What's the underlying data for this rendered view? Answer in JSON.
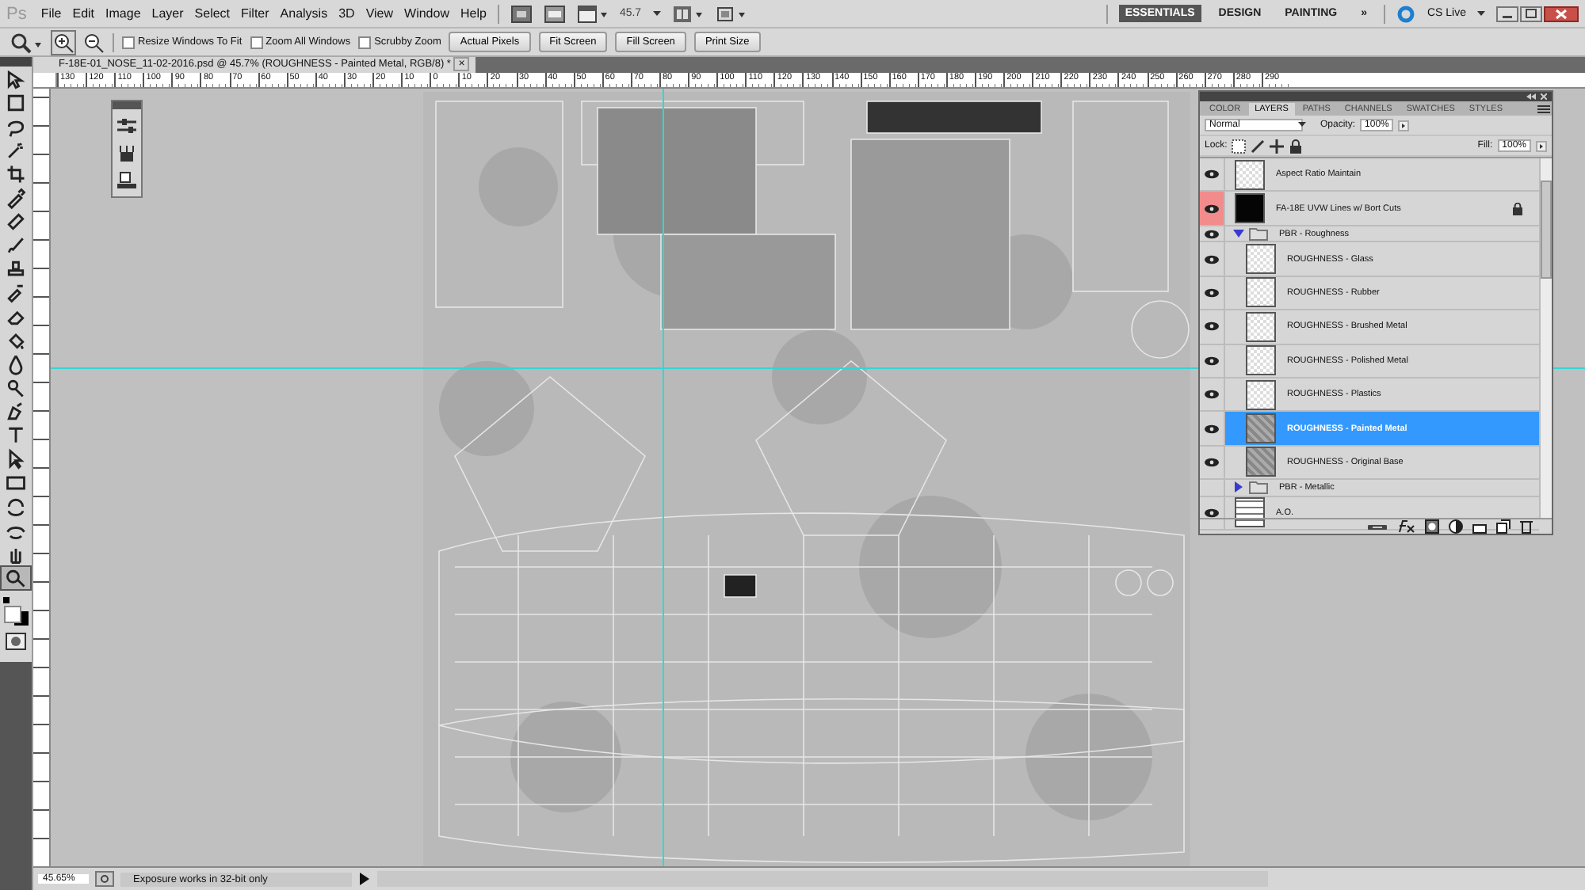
{
  "app_logo": "Ps",
  "menu": [
    "File",
    "Edit",
    "Image",
    "Layer",
    "Select",
    "Filter",
    "Analysis",
    "3D",
    "View",
    "Window",
    "Help"
  ],
  "zoom_level": "45.7",
  "workspaces": [
    {
      "label": "ESSENTIALS",
      "selected": true
    },
    {
      "label": "DESIGN",
      "selected": false
    },
    {
      "label": "PAINTING",
      "selected": false
    }
  ],
  "more_workspaces": "»",
  "cs_live": "CS Live",
  "options": {
    "checkboxes": [
      {
        "label": "Resize Windows To Fit",
        "checked": false
      },
      {
        "label": "Zoom All Windows",
        "checked": false
      },
      {
        "label": "Scrubby Zoom",
        "checked": false
      }
    ],
    "buttons": [
      "Actual Pixels",
      "Fit Screen",
      "Fill Screen",
      "Print Size"
    ]
  },
  "document_tab": {
    "title": "F-18E-01_NOSE_11-02-2016.psd @ 45.7% (ROUGHNESS - Painted Metal, RGB/8) *",
    "close": "×"
  },
  "ruler_labels": [
    "130",
    "120",
    "110",
    "100",
    "90",
    "80",
    "70",
    "60",
    "50",
    "40",
    "30",
    "20",
    "10",
    "0",
    "10",
    "20",
    "30",
    "40",
    "50",
    "60",
    "70",
    "80",
    "90",
    "100",
    "110",
    "120",
    "130",
    "140",
    "150",
    "160",
    "170",
    "180",
    "190",
    "200",
    "210",
    "220",
    "230",
    "240",
    "250",
    "260",
    "270",
    "280",
    "290"
  ],
  "tools": [
    {
      "kind": "move",
      "selected": false
    },
    {
      "kind": "marquee",
      "selected": false
    },
    {
      "kind": "lasso",
      "selected": false
    },
    {
      "kind": "wand",
      "selected": false
    },
    {
      "kind": "crop",
      "selected": false
    },
    {
      "kind": "eyedropper",
      "selected": false
    },
    {
      "kind": "healing",
      "selected": false
    },
    {
      "kind": "brush",
      "selected": false
    },
    {
      "kind": "stamp",
      "selected": false
    },
    {
      "kind": "history",
      "selected": false
    },
    {
      "kind": "eraser",
      "selected": false
    },
    {
      "kind": "bucket",
      "selected": false
    },
    {
      "kind": "blur",
      "selected": false
    },
    {
      "kind": "dodge",
      "selected": false
    },
    {
      "kind": "pen",
      "selected": false
    },
    {
      "kind": "type",
      "selected": false
    },
    {
      "kind": "select",
      "selected": false
    },
    {
      "kind": "shape",
      "selected": false
    },
    {
      "kind": "rotate3d",
      "selected": false
    },
    {
      "kind": "orbit3d",
      "selected": false
    },
    {
      "kind": "hand",
      "selected": false
    },
    {
      "kind": "zoom",
      "selected": true
    }
  ],
  "layers_panel": {
    "tabs": [
      {
        "label": "COLOR",
        "selected": false
      },
      {
        "label": "LAYERS",
        "selected": true
      },
      {
        "label": "PATHS",
        "selected": false
      },
      {
        "label": "CHANNELS",
        "selected": false
      },
      {
        "label": "SWATCHES",
        "selected": false
      },
      {
        "label": "STYLES",
        "selected": false
      }
    ],
    "blend_mode": "Normal",
    "opacity_label": "Opacity:",
    "opacity": "100%",
    "lock_label": "Lock:",
    "fill_label": "Fill:",
    "fill": "100%",
    "layers": [
      {
        "kind": "transparent",
        "name": "Aspect Ratio Maintain",
        "visible": true,
        "selected": false,
        "locked": false
      },
      {
        "kind": "lines",
        "name": "FA-18E UVW Lines w/ Bort Cuts",
        "visible": true,
        "selected": false,
        "locked": true,
        "color": "#f28b8b"
      },
      {
        "kind": "group",
        "name": "PBR - Roughness",
        "visible": true,
        "expanded": true,
        "children": [
          {
            "kind": "transparent",
            "name": "ROUGHNESS - Glass",
            "visible": true,
            "selected": false,
            "locked": false
          },
          {
            "kind": "transparent",
            "name": "ROUGHNESS - Rubber",
            "visible": true,
            "selected": false,
            "locked": false
          },
          {
            "kind": "transparent",
            "name": "ROUGHNESS - Brushed Metal",
            "visible": true,
            "selected": false,
            "locked": false
          },
          {
            "kind": "transparent",
            "name": "ROUGHNESS - Polished Metal",
            "visible": true,
            "selected": false,
            "locked": false
          },
          {
            "kind": "transparent",
            "name": "ROUGHNESS - Plastics",
            "visible": true,
            "selected": false,
            "locked": false
          },
          {
            "kind": "texture",
            "name": "ROUGHNESS - Painted Metal",
            "visible": true,
            "selected": true,
            "locked": false
          },
          {
            "kind": "texture",
            "name": "ROUGHNESS - Original Base",
            "visible": true,
            "selected": false,
            "locked": false
          }
        ]
      },
      {
        "kind": "group",
        "name": "PBR - Metallic",
        "visible": false,
        "expanded": false
      },
      {
        "kind": "ao",
        "name": "A.O.",
        "visible": true,
        "selected": false,
        "locked": false
      }
    ]
  },
  "status_bar": {
    "zoom": "45.65%",
    "info": "Exposure works in 32-bit only"
  }
}
